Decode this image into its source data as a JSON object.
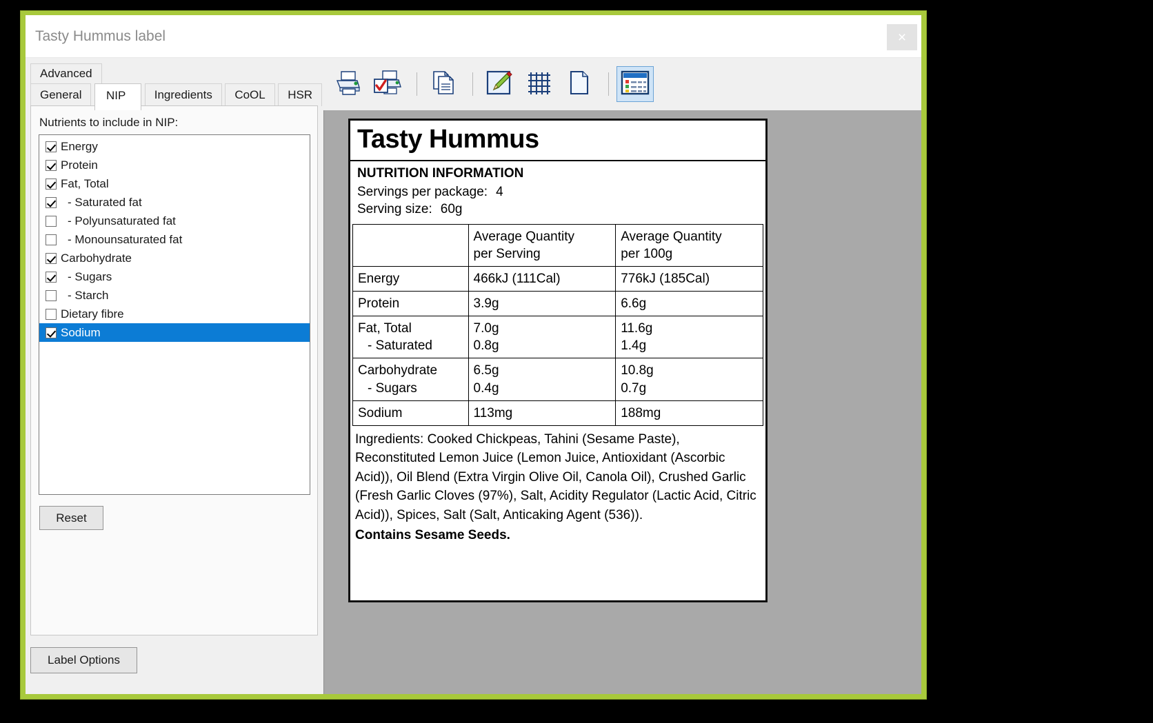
{
  "window": {
    "title": "Tasty Hummus label",
    "close_label": "×"
  },
  "tabs": {
    "top_row": [
      {
        "label": "Advanced",
        "active": false
      }
    ],
    "bottom_row": [
      {
        "label": "General",
        "active": false
      },
      {
        "label": "NIP",
        "active": true
      },
      {
        "label": "Ingredients",
        "active": false
      },
      {
        "label": "CoOL",
        "active": false
      },
      {
        "label": "HSR",
        "active": false
      }
    ]
  },
  "left_panel": {
    "group_label": "Nutrients to include in NIP:",
    "nutrients": [
      {
        "label": "Energy",
        "checked": true,
        "indent": false,
        "selected": false
      },
      {
        "label": "Protein",
        "checked": true,
        "indent": false,
        "selected": false
      },
      {
        "label": "Fat, Total",
        "checked": true,
        "indent": false,
        "selected": false
      },
      {
        "label": "- Saturated fat",
        "checked": true,
        "indent": true,
        "selected": false
      },
      {
        "label": "- Polyunsaturated fat",
        "checked": false,
        "indent": true,
        "selected": false
      },
      {
        "label": "- Monounsaturated fat",
        "checked": false,
        "indent": true,
        "selected": false
      },
      {
        "label": "Carbohydrate",
        "checked": true,
        "indent": false,
        "selected": false
      },
      {
        "label": "- Sugars",
        "checked": true,
        "indent": true,
        "selected": false
      },
      {
        "label": "- Starch",
        "checked": false,
        "indent": true,
        "selected": false
      },
      {
        "label": "Dietary fibre",
        "checked": false,
        "indent": false,
        "selected": false
      },
      {
        "label": "Sodium",
        "checked": true,
        "indent": false,
        "selected": true
      }
    ],
    "reset_label": "Reset",
    "label_options_label": "Label Options"
  },
  "toolbar": {
    "buttons": [
      {
        "name": "print-icon",
        "active": false
      },
      {
        "name": "print-preview-icon",
        "active": false
      },
      {
        "separator_after": true
      },
      {
        "name": "copy-icon",
        "active": false
      },
      {
        "separator_after": true
      },
      {
        "name": "edit-pencil-icon",
        "active": false
      },
      {
        "name": "grid-icon",
        "active": false
      },
      {
        "name": "new-page-icon",
        "active": false
      },
      {
        "separator_after": true
      },
      {
        "name": "details-view-icon",
        "active": true
      }
    ]
  },
  "label_preview": {
    "product_name": "Tasty Hummus",
    "nip_heading": "NUTRITION INFORMATION",
    "servings_per_package_label": "Servings per package:",
    "servings_per_package_value": "4",
    "serving_size_label": "Serving size:",
    "serving_size_value": "60g",
    "table": {
      "headers": [
        "",
        "Average Quantity\nper Serving",
        "Average Quantity\nper 100g"
      ],
      "header_col2_line1": "Average Quantity",
      "header_col2_line2": "per Serving",
      "header_col3_line1": "Average Quantity",
      "header_col3_line2": "per 100g",
      "rows": [
        {
          "name": "Energy",
          "sub": null,
          "per_serving": "466kJ (111Cal)",
          "sub_per_serving": null,
          "per_100g": "776kJ (185Cal)",
          "sub_per_100g": null
        },
        {
          "name": "Protein",
          "sub": null,
          "per_serving": "3.9g",
          "sub_per_serving": null,
          "per_100g": "6.6g",
          "sub_per_100g": null
        },
        {
          "name": "Fat, Total",
          "sub": "- Saturated",
          "per_serving": "7.0g",
          "sub_per_serving": "0.8g",
          "per_100g": "11.6g",
          "sub_per_100g": "1.4g"
        },
        {
          "name": "Carbohydrate",
          "sub": "- Sugars",
          "per_serving": "6.5g",
          "sub_per_serving": "0.4g",
          "per_100g": "10.8g",
          "sub_per_100g": "0.7g"
        },
        {
          "name": "Sodium",
          "sub": null,
          "per_serving": "113mg",
          "sub_per_serving": null,
          "per_100g": "188mg",
          "sub_per_100g": null
        }
      ]
    },
    "ingredients_text": "Ingredients: Cooked Chickpeas, Tahini (Sesame Paste), Reconstituted Lemon Juice (Lemon Juice, Antioxidant (Ascorbic Acid)), Oil Blend (Extra Virgin Olive Oil, Canola Oil), Crushed Garlic (Fresh Garlic Cloves (97%), Salt, Acidity Regulator (Lactic Acid, Citric Acid)), Spices, Salt (Salt, Anticaking Agent (536)).",
    "allergen_statement": "Contains Sesame Seeds."
  },
  "colors": {
    "frame_green": "#a8c93c",
    "selection_blue": "#0c7cd5",
    "toolbar_active": "#cfe4f7",
    "preview_background": "#a9a9a9"
  }
}
